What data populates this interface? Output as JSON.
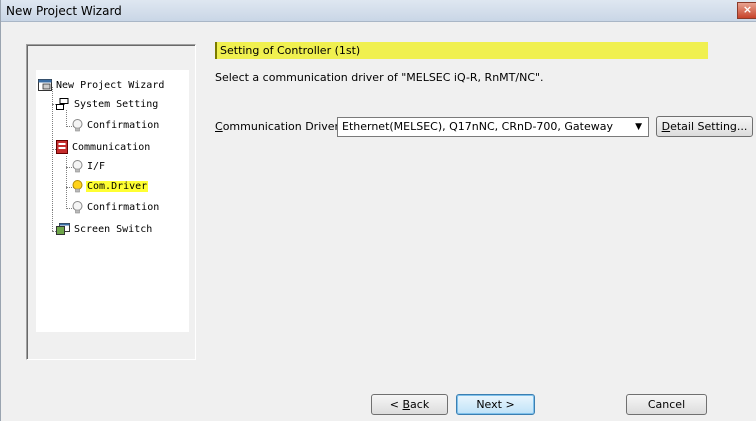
{
  "window": {
    "title": "New Project Wizard",
    "close_label": "×"
  },
  "tree": {
    "items": [
      {
        "id": "root",
        "label": "New Project Wizard",
        "icon": "wizard-icon"
      },
      {
        "id": "system-setting",
        "label": "System Setting",
        "icon": "network-icon"
      },
      {
        "id": "sys-confirmation",
        "label": "Confirmation",
        "icon": "bulb-icon"
      },
      {
        "id": "communication",
        "label": "Communication",
        "icon": "plc-icon"
      },
      {
        "id": "if",
        "label": "I/F",
        "icon": "bulb-icon"
      },
      {
        "id": "com-driver",
        "label": "Com.Driver",
        "icon": "bulb-lit-icon",
        "selected": true
      },
      {
        "id": "com-confirmation",
        "label": "Confirmation",
        "icon": "bulb-icon"
      },
      {
        "id": "screen-switch",
        "label": "Screen Switch",
        "icon": "screen-icon"
      }
    ]
  },
  "main": {
    "header": "Setting of Controller (1st)",
    "description": "Select a communication driver of \"MELSEC iQ-R, RnMT/NC\".",
    "driver_label_accel": "C",
    "driver_label_rest": "ommunication Driver:",
    "driver_value": "Ethernet(MELSEC), Q17nNC, CRnD-700, Gateway",
    "detail_accel": "D",
    "detail_rest": "etail Setting..."
  },
  "footer": {
    "back_pre": "< ",
    "back_accel": "B",
    "back_rest": "ack",
    "next_label": "Next >",
    "cancel_label": "Cancel"
  }
}
